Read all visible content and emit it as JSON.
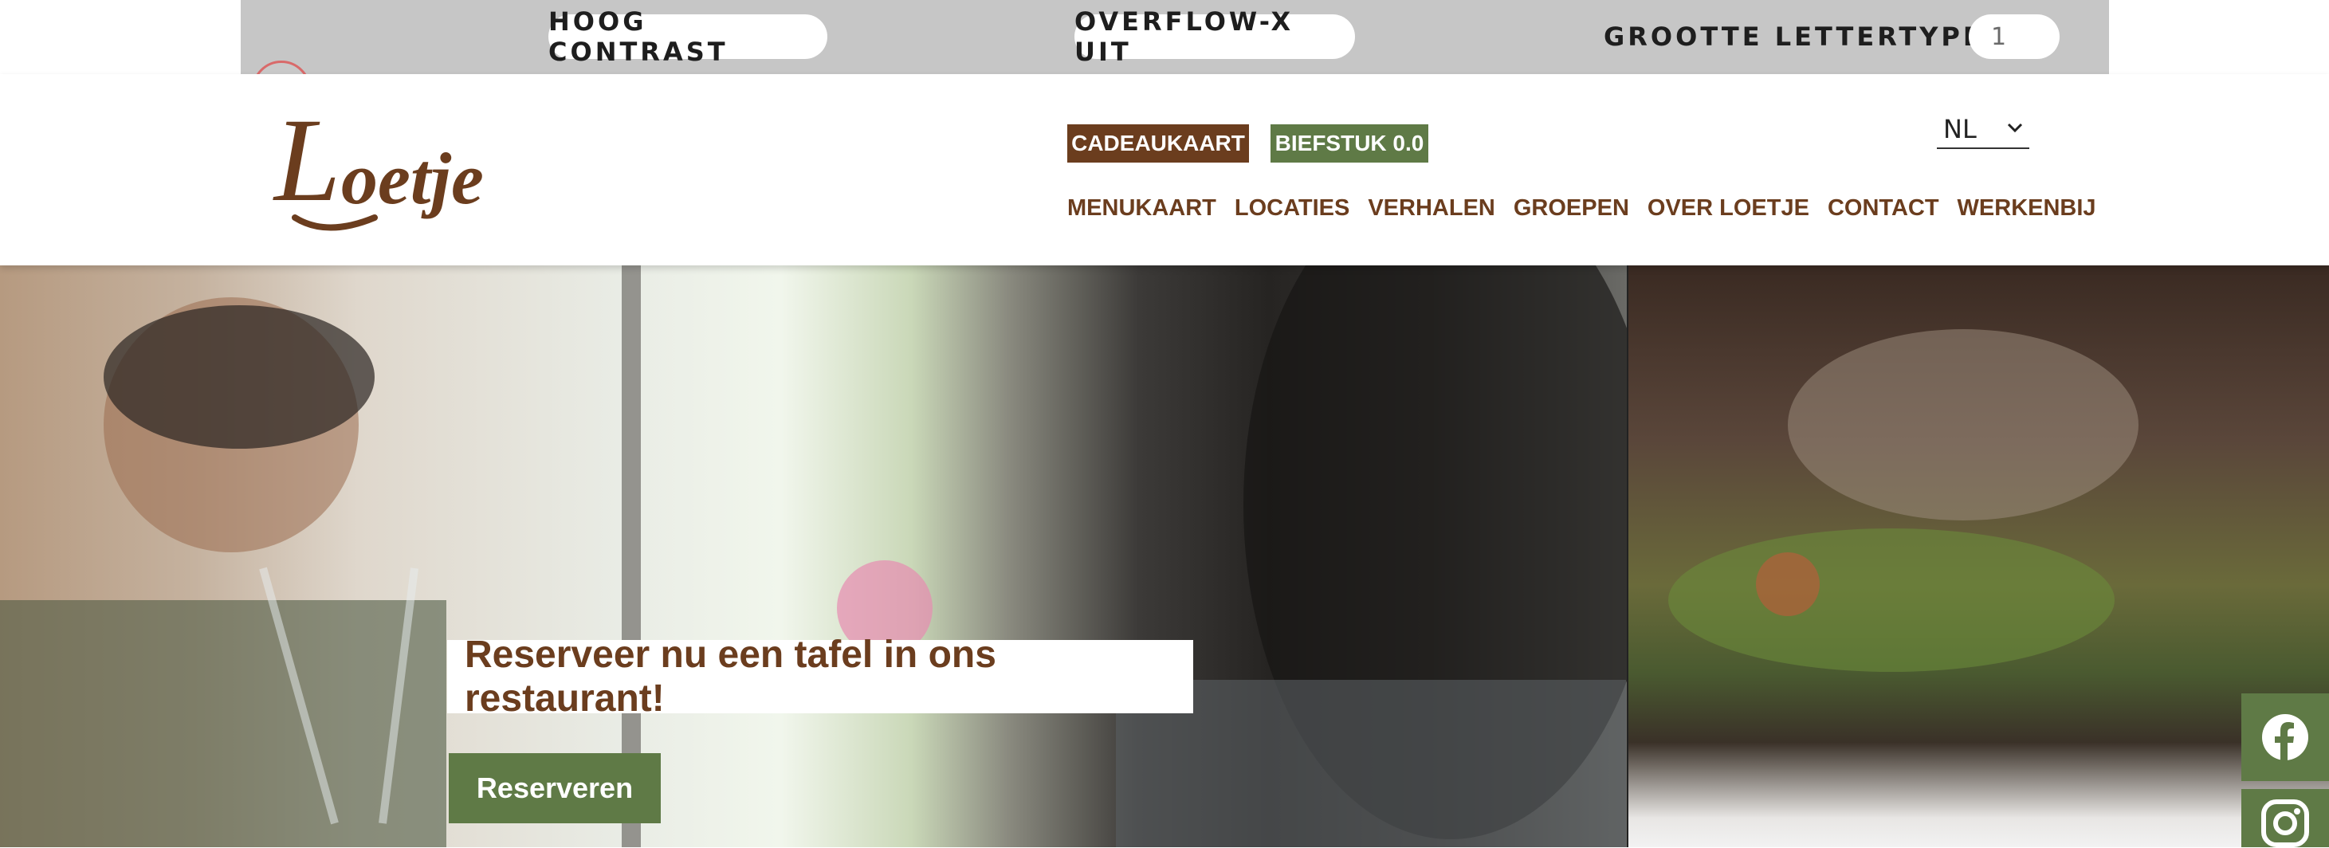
{
  "accessibility_bar": {
    "high_contrast_label": "HOOG CONTRAST",
    "overflow_label": "OVERFLOW-X UIT",
    "font_size_label": "GROOTTE LETTERTYPE (X):",
    "font_size_value": "1"
  },
  "header": {
    "logo_text": "Loetje",
    "gift_card_label": "CADEAUKAART",
    "steak_label": "BIEFSTUK 0.0",
    "language": "NL",
    "nav": [
      {
        "label": "MENUKAART"
      },
      {
        "label": "LOCATIES"
      },
      {
        "label": "VERHALEN"
      },
      {
        "label": "GROEPEN"
      },
      {
        "label": "OVER LOETJE"
      },
      {
        "label": "CONTACT"
      },
      {
        "label": "WERKENBIJ"
      }
    ]
  },
  "hero": {
    "caption": "Reserveer nu een tafel in ons restaurant!",
    "reserve_button": "Reserveren"
  },
  "colors": {
    "brand_brown": "#6b3d1e",
    "brand_green": "#5f7a46",
    "toolbar_gray": "#c6c6c6"
  },
  "icons": [
    "close-icon",
    "chevron-down-icon",
    "facebook-icon",
    "instagram-icon"
  ]
}
